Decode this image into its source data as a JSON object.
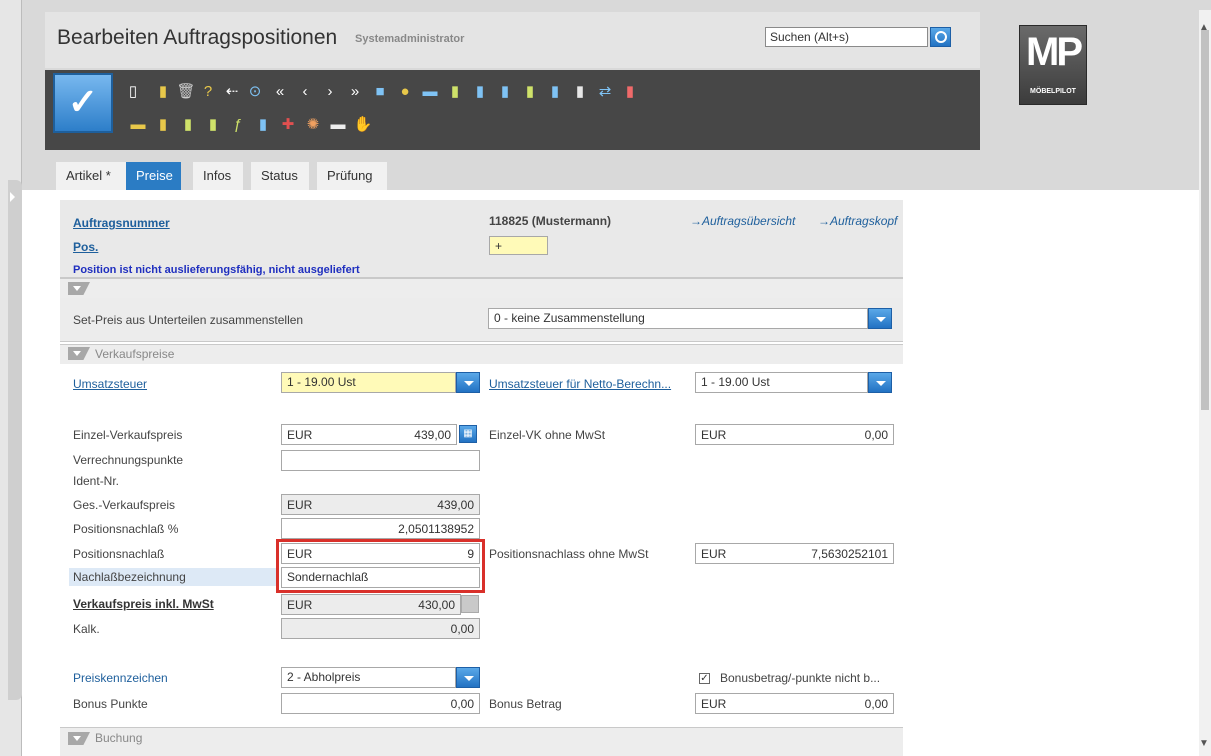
{
  "header": {
    "title": "Bearbeiten Auftragspositionen",
    "user": "Systemadministrator",
    "search_placeholder": "Suchen (Alt+s)",
    "logo_text": "MP",
    "logo_sub": "MÖBELPILOT"
  },
  "toolbar": {
    "confirm_label": "✓",
    "icons": [
      "new-doc-icon",
      "book-icon",
      "trash-icon",
      "help-icon",
      "back-icon",
      "search-icon",
      "first-icon",
      "prev-icon",
      "next-icon",
      "last-icon",
      "cube-icon",
      "coins-icon",
      "truck-icon",
      "doc-check-icon",
      "doc-share-icon",
      "doc-table-icon",
      "doc-list-icon",
      "doc-stack-icon",
      "doc-copy-icon",
      "transfer-icon",
      "pdf-icon",
      "money-icon",
      "book-open-icon",
      "doc-green-icon",
      "doc-user-icon",
      "function-icon",
      "doc-check2-icon",
      "flag-uk-icon",
      "wheel-icon",
      "printer-icon",
      "hand-icon"
    ]
  },
  "tabs": [
    {
      "label": "Artikel *",
      "active": false
    },
    {
      "label": "Preise",
      "active": true
    },
    {
      "label": "Infos",
      "active": false
    },
    {
      "label": "Status",
      "active": false
    },
    {
      "label": "Prüfung",
      "active": false
    }
  ],
  "order": {
    "number_label": "Auftragsnummer",
    "number_value": "118825 (Mustermann)",
    "pos_label": "Pos.",
    "pos_value": "+",
    "link_overview": "→Auftragsübersicht",
    "link_head": "→Auftragskopf",
    "warning": "Position ist nicht auslieferungsfähig, nicht ausgeliefert"
  },
  "set_price": {
    "label": "Set-Preis aus Unterteilen zusammenstellen",
    "value": "0 - keine Zusammenstellung"
  },
  "sales": {
    "section_title": "Verkaufspreise",
    "vat_label": "Umsatzsteuer",
    "vat_value": "1 - 19.00 Ust",
    "vat_net_label": "Umsatzsteuer für Netto-Berechn...",
    "vat_net_value": "1 - 19.00 Ust",
    "unit_price_label": "Einzel-Verkaufspreis",
    "unit_price_currency": "EUR",
    "unit_price_value": "439,00",
    "unit_net_label": "Einzel-VK ohne MwSt",
    "unit_net_currency": "EUR",
    "unit_net_value": "0,00",
    "points_label": "Verrechnungspunkte",
    "ident_label": "Ident-Nr.",
    "total_label": "Ges.-Verkaufspreis",
    "total_currency": "EUR",
    "total_value": "439,00",
    "discount_pct_label": "Positionsnachlaß %",
    "discount_pct_value": "2,0501138952",
    "discount_label": "Positionsnachlaß",
    "discount_currency": "EUR",
    "discount_value": "9",
    "discount_net_label": "Positionsnachlass ohne MwSt",
    "discount_net_currency": "EUR",
    "discount_net_value": "7,5630252101",
    "discount_name_label": "Nachlaßbezeichnung",
    "discount_name_value": "Sondernachlaß",
    "final_label": "Verkaufspreis inkl. MwSt",
    "final_currency": "EUR",
    "final_value": "430,00",
    "calc_label": "Kalk.",
    "calc_value": "0,00",
    "price_flag_label": "Preiskennzeichen",
    "price_flag_value": "2 - Abholpreis",
    "bonus_check_label": "Bonusbetrag/-punkte nicht b...",
    "bonus_points_label": "Bonus Punkte",
    "bonus_points_value": "0,00",
    "bonus_amount_label": "Bonus Betrag",
    "bonus_amount_currency": "EUR",
    "bonus_amount_value": "0,00"
  },
  "booking": {
    "section_title": "Buchung"
  }
}
